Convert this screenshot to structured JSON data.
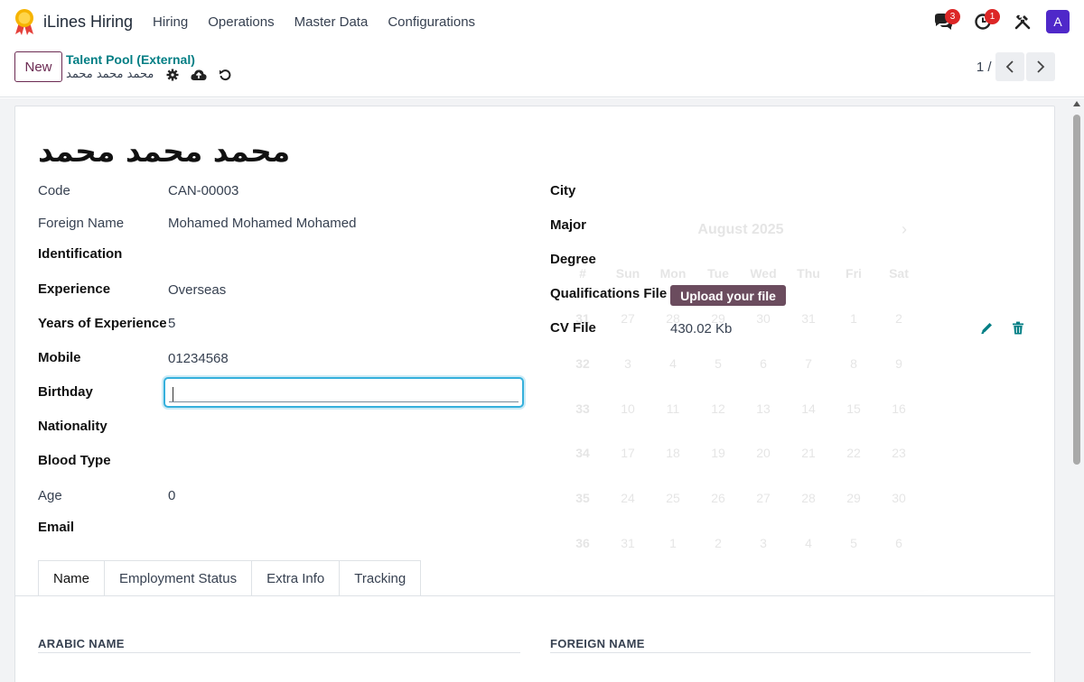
{
  "nav": {
    "app_title": "iLines Hiring",
    "menu": [
      "Hiring",
      "Operations",
      "Master Data",
      "Configurations"
    ],
    "messages_badge": "3",
    "activities_badge": "1",
    "avatar_initial": "A"
  },
  "control": {
    "new_label": "New",
    "breadcrumb_parent": "Talent Pool (External)",
    "breadcrumb_current": "محمد محمد محمد",
    "pager": "1 / 1"
  },
  "record": {
    "title": "محمد محمد محمد",
    "left_fields": [
      {
        "label": "Code",
        "value": "CAN-00003",
        "bold": false
      },
      {
        "label": "Foreign Name",
        "value": "Mohamed Mohamed Mohamed",
        "bold": false
      },
      {
        "label": "Identification",
        "value": "",
        "bold": true
      },
      {
        "label": "Experience",
        "value": "Overseas",
        "bold": true
      },
      {
        "label": "Years of Experience",
        "value": "5",
        "bold": true
      },
      {
        "label": "Mobile",
        "value": "01234568",
        "bold": true
      },
      {
        "label": "Birthday",
        "value": "",
        "bold": true
      },
      {
        "label": "Nationality",
        "value": "",
        "bold": true
      },
      {
        "label": "Blood Type",
        "value": "",
        "bold": true
      },
      {
        "label": "Age",
        "value": "0",
        "bold": false
      },
      {
        "label": "Email",
        "value": "",
        "bold": true
      }
    ],
    "right_fields": [
      {
        "label": "City",
        "value": ""
      },
      {
        "label": "Major",
        "value": ""
      },
      {
        "label": "Degree",
        "value": ""
      },
      {
        "label": "Qualifications File",
        "value": ""
      },
      {
        "label": "CV File",
        "value": "430.02 Kb"
      }
    ],
    "upload_label": "Upload your file"
  },
  "calendar": {
    "month": "August 2025",
    "headers": [
      "#",
      "Sun",
      "Mon",
      "Tue",
      "Wed",
      "Thu",
      "Fri",
      "Sat"
    ],
    "weeks": [
      [
        "31",
        "27",
        "28",
        "29",
        "30",
        "31",
        "1",
        "2"
      ],
      [
        "32",
        "3",
        "4",
        "5",
        "6",
        "7",
        "8",
        "9"
      ],
      [
        "33",
        "10",
        "11",
        "12",
        "13",
        "14",
        "15",
        "16"
      ],
      [
        "34",
        "17",
        "18",
        "19",
        "20",
        "21",
        "22",
        "23"
      ],
      [
        "35",
        "24",
        "25",
        "26",
        "27",
        "28",
        "29",
        "30"
      ],
      [
        "36",
        "31",
        "1",
        "2",
        "3",
        "4",
        "5",
        "6"
      ]
    ]
  },
  "tabs": [
    "Name",
    "Employment Status",
    "Extra Info",
    "Tracking"
  ],
  "sections": {
    "arabic_name": "ARABIC NAME",
    "foreign_name": "FOREIGN NAME"
  },
  "colors": {
    "accent": "#6b2a52",
    "link": "#017e84",
    "upload_bg": "#6b4c5e",
    "badge": "#dc2626",
    "avatar": "#4f28c9",
    "focus": "#35b0dc"
  }
}
